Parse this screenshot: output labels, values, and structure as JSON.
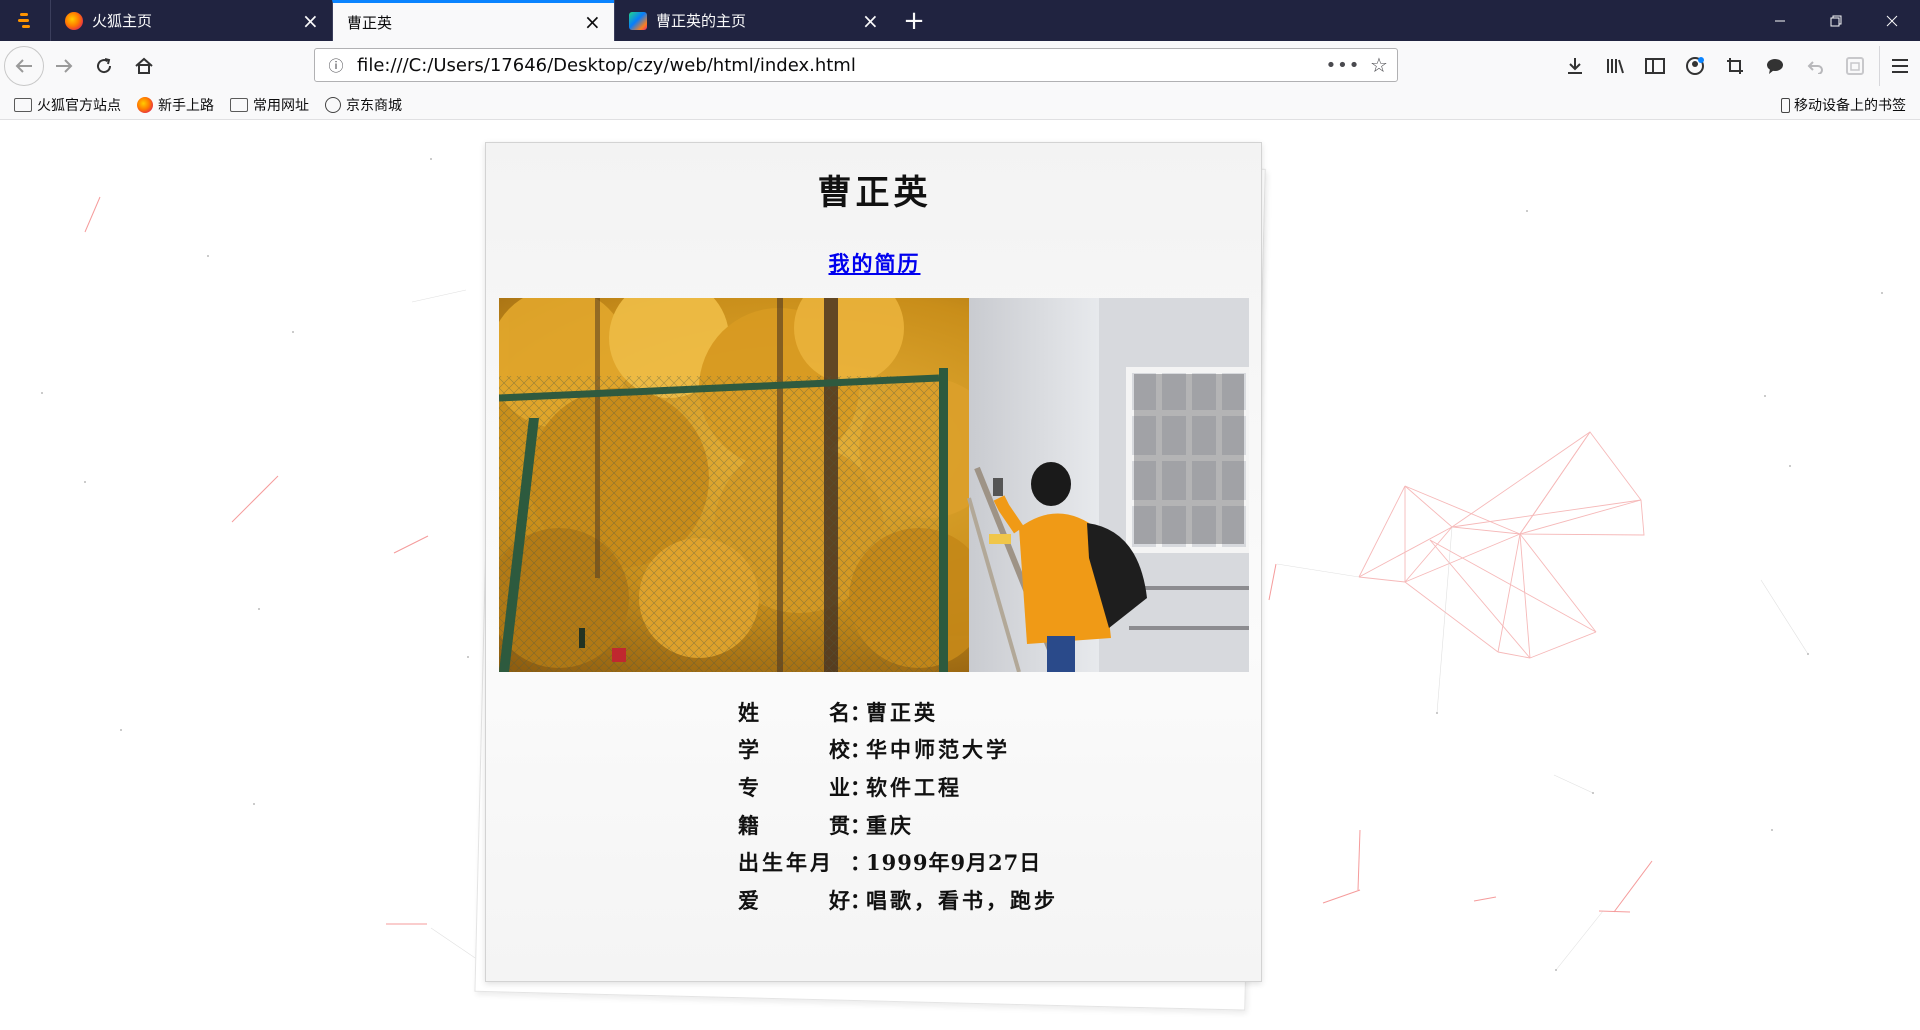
{
  "browser": {
    "tabs": [
      {
        "title": "火狐主页",
        "active": false
      },
      {
        "title": "曹正英",
        "active": true
      },
      {
        "title": "曹正英的主页",
        "active": false
      }
    ],
    "new_tab": "+",
    "url": "file:///C:/Users/17646/Desktop/czy/web/html/index.html",
    "url_more": "•••",
    "bookmarks": [
      "火狐官方站点",
      "新手上路",
      "常用网址",
      "京东商城"
    ],
    "mobile_bookmarks": "移动设备上的书签",
    "accent": "#0a84ff",
    "chrome_dark": "#202340"
  },
  "page": {
    "name": "曹正英",
    "resume_link": "我的简历",
    "info": [
      {
        "label": "姓名",
        "value": "曹正英"
      },
      {
        "label": "学校",
        "value": "华中师范大学"
      },
      {
        "label": "专业",
        "value": "软件工程"
      },
      {
        "label": "籍贯",
        "value": "重庆"
      },
      {
        "label": "出生年月",
        "value": "1999年9月27日"
      },
      {
        "label": "爱好",
        "value": "唱歌，看书，跑步"
      }
    ],
    "colon": "："
  }
}
